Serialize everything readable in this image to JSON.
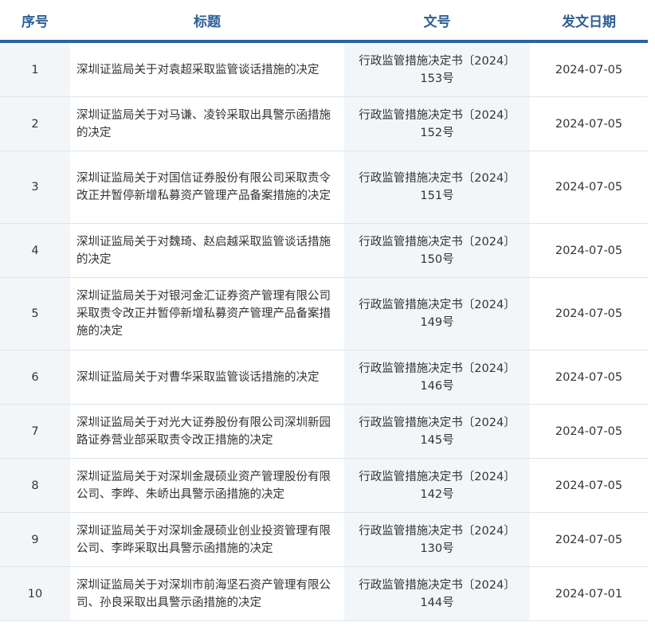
{
  "table": {
    "headers": {
      "no": "序号",
      "title": "标题",
      "doc": "文号",
      "date": "发文日期"
    },
    "rows": [
      {
        "no": "1",
        "title": "深圳证监局关于对袁超采取监管谈话措施的决定",
        "doc": "行政监管措施决定书〔2024〕153号",
        "date": "2024-07-05"
      },
      {
        "no": "2",
        "title": "深圳证监局关于对马谦、凌铃采取出具警示函措施的决定",
        "doc": "行政监管措施决定书〔2024〕152号",
        "date": "2024-07-05"
      },
      {
        "no": "3",
        "title": "深圳证监局关于对国信证券股份有限公司采取责令改正并暂停新增私募资产管理产品备案措施的决定",
        "doc": "行政监管措施决定书〔2024〕151号",
        "date": "2024-07-05"
      },
      {
        "no": "4",
        "title": "深圳证监局关于对魏琦、赵启越采取监管谈话措施的决定",
        "doc": "行政监管措施决定书〔2024〕150号",
        "date": "2024-07-05"
      },
      {
        "no": "5",
        "title": "深圳证监局关于对银河金汇证券资产管理有限公司采取责令改正并暂停新增私募资产管理产品备案措施的决定",
        "doc": "行政监管措施决定书〔2024〕149号",
        "date": "2024-07-05"
      },
      {
        "no": "6",
        "title": "深圳证监局关于对曹华采取监管谈话措施的决定",
        "doc": "行政监管措施决定书〔2024〕146号",
        "date": "2024-07-05"
      },
      {
        "no": "7",
        "title": "深圳证监局关于对光大证券股份有限公司深圳新园路证券营业部采取责令改正措施的决定",
        "doc": "行政监管措施决定书〔2024〕145号",
        "date": "2024-07-05"
      },
      {
        "no": "8",
        "title": "深圳证监局关于对深圳金晟硕业资产管理股份有限公司、李晔、朱峤出具警示函措施的决定",
        "doc": "行政监管措施决定书〔2024〕142号",
        "date": "2024-07-05"
      },
      {
        "no": "9",
        "title": "深圳证监局关于对深圳金晟硕业创业投资管理有限公司、李晔采取出具警示函措施的决定",
        "doc": "行政监管措施决定书〔2024〕130号",
        "date": "2024-07-05"
      },
      {
        "no": "10",
        "title": "深圳证监局关于对深圳市前海坚石资产管理有限公司、孙良采取出具警示函措施的决定",
        "doc": "行政监管措施决定书〔2024〕144号",
        "date": "2024-07-01"
      }
    ]
  }
}
